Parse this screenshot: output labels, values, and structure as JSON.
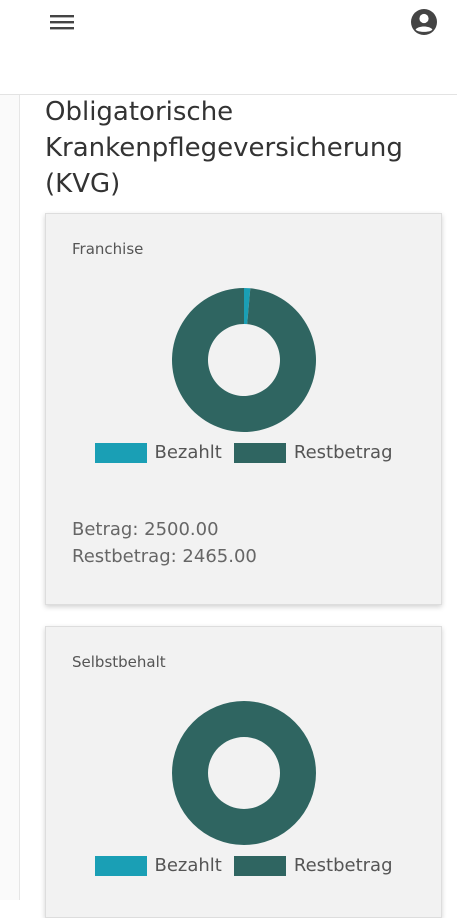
{
  "header": {
    "menu_icon": "menu-icon",
    "account_icon": "account-circle-icon"
  },
  "page": {
    "title": "Obligatorische Krankenpflegeversicherung (KVG)"
  },
  "colors": {
    "bezahlt": "#1a9fb5",
    "restbetrag": "#2f6561",
    "card_bg": "#f2f2f2"
  },
  "cards": [
    {
      "title": "Franchise",
      "legend": [
        "Bezahlt",
        "Restbetrag"
      ],
      "betrag_text": "Betrag: 2500.00",
      "restbetrag_text": "Restbetrag: 2465.00",
      "chart_data": {
        "type": "pie",
        "categories": [
          "Bezahlt",
          "Restbetrag"
        ],
        "values": [
          35,
          2465
        ]
      }
    },
    {
      "title": "Selbstbehalt",
      "legend": [
        "Bezahlt",
        "Restbetrag"
      ],
      "chart_data": {
        "type": "pie",
        "categories": [
          "Bezahlt",
          "Restbetrag"
        ],
        "values": [
          0,
          1
        ]
      }
    }
  ]
}
